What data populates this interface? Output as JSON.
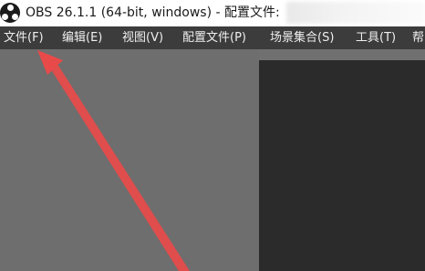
{
  "window": {
    "title": "OBS 26.1.1 (64-bit, windows) - 配置文件:"
  },
  "menubar": {
    "items": [
      {
        "label": "文件(F)"
      },
      {
        "label": "编辑(E)"
      },
      {
        "label": "视图(V)"
      },
      {
        "label": "配置文件(P)"
      },
      {
        "label": "场景集合(S)"
      },
      {
        "label": "工具(T)"
      },
      {
        "label": "帮"
      }
    ]
  },
  "colors": {
    "menubar_bg": "#3c3c3c",
    "canvas_bg": "#6e6e6e",
    "preview_bg": "#2b2b2b",
    "annotation_arrow": "#e84a4a"
  },
  "icons": {
    "app_logo": "obs-logo-icon"
  }
}
